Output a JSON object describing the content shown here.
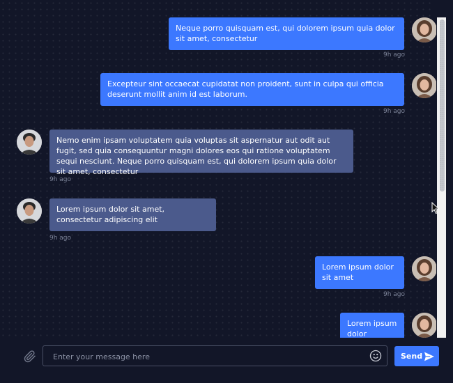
{
  "messages": [
    {
      "side": "out",
      "text": "Neque porro quisquam est, qui dolorem ipsum quia dolor sit amet, consectetur",
      "time": "9h ago"
    },
    {
      "side": "out",
      "text": "Excepteur sint occaecat cupidatat non proident, sunt in culpa qui officia deserunt mollit anim id est laborum.",
      "time": "9h ago"
    },
    {
      "side": "in",
      "text": "Nemo enim ipsam voluptatem quia voluptas sit aspernatur aut odit aut fugit, sed quia consequuntur magni dolores eos qui ratione voluptatem sequi nesciunt. Neque porro quisquam est, qui dolorem ipsum quia dolor sit amet, consectetur",
      "time": "9h ago"
    },
    {
      "side": "in",
      "text": "Lorem ipsum dolor sit amet, consectetur adipiscing elit",
      "time": "9h ago"
    },
    {
      "side": "out",
      "text": "Lorem ipsum dolor sit amet",
      "time": "9h ago"
    },
    {
      "side": "out",
      "text": "Lorem ipsum dolor",
      "time": ""
    }
  ],
  "composer": {
    "placeholder": "Enter your message here",
    "value": "",
    "send_label": "Send"
  },
  "icons": {
    "attach": "paperclip-icon",
    "emoji": "smiley-icon",
    "send": "paper-plane-icon"
  },
  "colors": {
    "background": "#121628",
    "outgoing_bubble": "#3c78ff",
    "incoming_bubble": "#4b5a8c",
    "timestamp": "#7c8398"
  }
}
